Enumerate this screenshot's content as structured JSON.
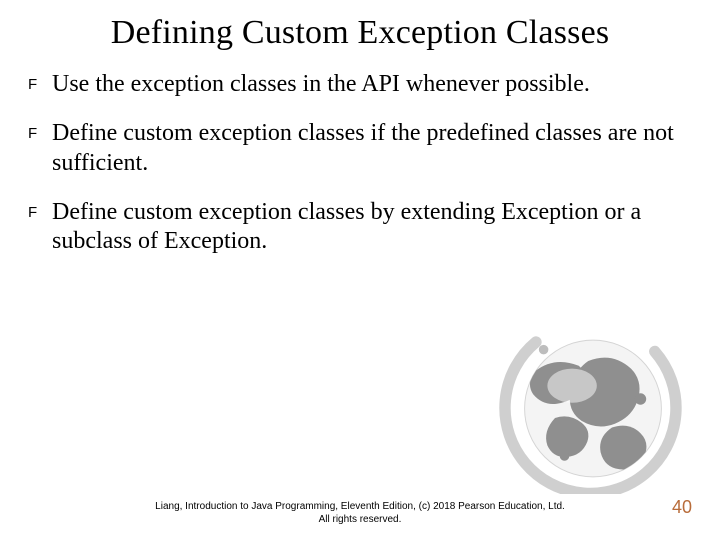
{
  "title": "Defining Custom Exception Classes",
  "bullets": [
    {
      "marker": "F",
      "text": "Use the exception classes in the API whenever possible."
    },
    {
      "marker": "F",
      "text": "Define custom exception classes if the predefined classes are not sufficient."
    },
    {
      "marker": "F",
      "text": "Define custom exception classes by extending Exception or a subclass of Exception."
    }
  ],
  "footer": {
    "line1": "Liang, Introduction to Java Programming, Eleventh Edition, (c) 2018 Pearson Education, Ltd.",
    "line2": "All rights reserved."
  },
  "page_number": "40"
}
